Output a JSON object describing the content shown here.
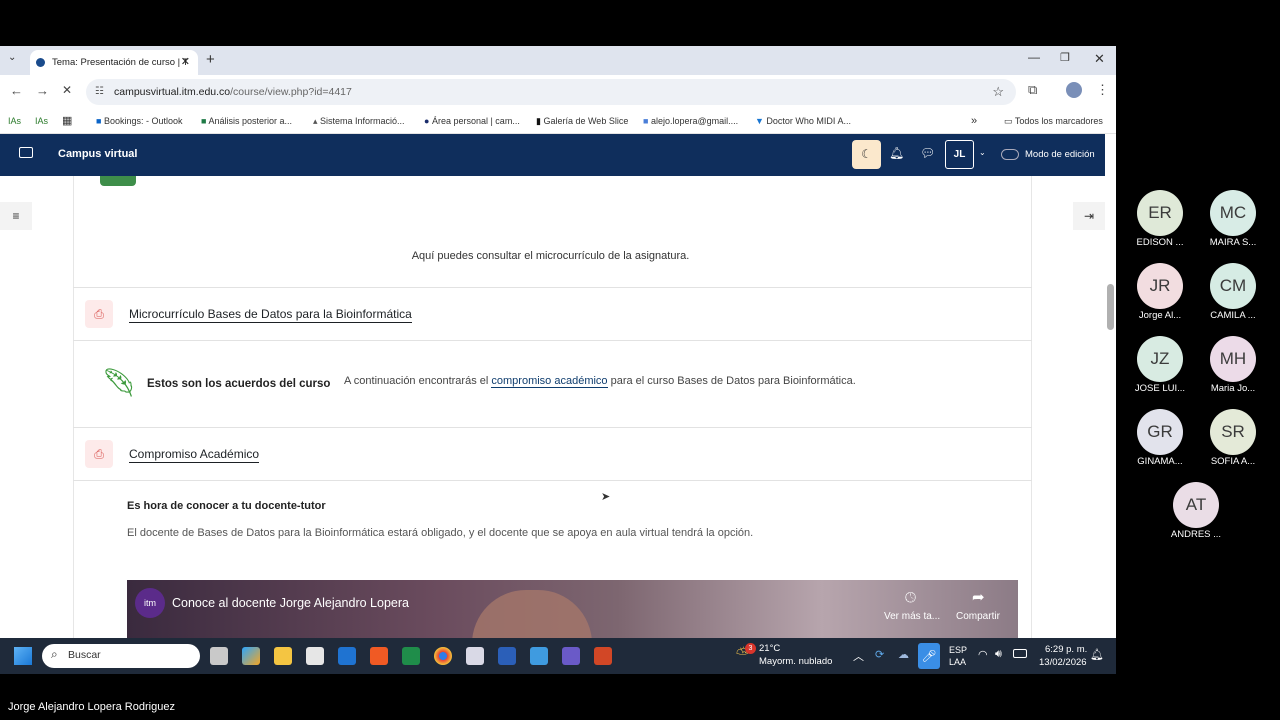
{
  "browser": {
    "tab_title": "Tema: Presentación de curso | T",
    "url_host": "campusvirtual.itm.edu.co",
    "url_path": "/course/view.php?id=4417",
    "bookmarks": [
      "IAs",
      "IAs",
      "Bookings: - Outlook",
      "Análisis posterior a...",
      "Sistema Informació...",
      "Área personal | cam...",
      "Galería de Web Slice",
      "alejo.lopera@gmail....",
      "Doctor Who MIDI A..."
    ],
    "all_bookmarks": "Todos los marcadores"
  },
  "moodle": {
    "site_name": "Campus virtual",
    "user_initials": "JL",
    "edit_mode": "Modo de edición",
    "microcurriculo_intro": "Aquí puedes consultar el microcurrículo de la asignatura.",
    "microcurriculo_link": "Microcurrículo Bases de Datos para la Bioinformática",
    "acuerdos_title": "Estos son los acuerdos del curso",
    "acuerdos_text_pre": "A continuación encontrarás el",
    "acuerdos_link": "compromiso académico",
    "acuerdos_text_post": "para el curso Bases de Datos para Bioinformática.",
    "compromiso_link": "Compromiso Académico",
    "docente_heading": "Es hora de conocer a tu docente-tutor",
    "docente_text": "El docente de Bases de Datos para la Bioinformática estará obligado, y el docente que se apoya en aula virtual tendrá la opción.",
    "video_title": "Conoce al docente Jorge Alejandro Lopera",
    "video_watch_later": "Ver más ta...",
    "video_share": "Compartir"
  },
  "taskbar": {
    "search": "Buscar",
    "weather_temp": "21°C",
    "weather_desc": "Mayorm. nublado",
    "weather_badge": "3",
    "lang1": "ESP",
    "lang2": "LAA",
    "time": "6:29 p. m.",
    "date": "13/02/2026"
  },
  "participants": [
    {
      "initials": "ER",
      "name": "EDISON ...",
      "color": "#dfe9d8"
    },
    {
      "initials": "MC",
      "name": "MAIRA S...",
      "color": "#d8ece6"
    },
    {
      "initials": "JR",
      "name": "Jorge Al...",
      "color": "#f2dde0"
    },
    {
      "initials": "CM",
      "name": "CAMILA ...",
      "color": "#d6ece4"
    },
    {
      "initials": "JZ",
      "name": "JOSE LUI...",
      "color": "#d8ebe2"
    },
    {
      "initials": "MH",
      "name": "Maria Jo...",
      "color": "#ecdbe8"
    },
    {
      "initials": "GR",
      "name": "GINAMA...",
      "color": "#e2e3ec"
    },
    {
      "initials": "SR",
      "name": "SOFIA A...",
      "color": "#e4ead8"
    },
    {
      "initials": "AT",
      "name": "ANDRES ...",
      "color": "#eadde6"
    }
  ],
  "presenter_name": "Jorge Alejandro Lopera Rodriguez"
}
